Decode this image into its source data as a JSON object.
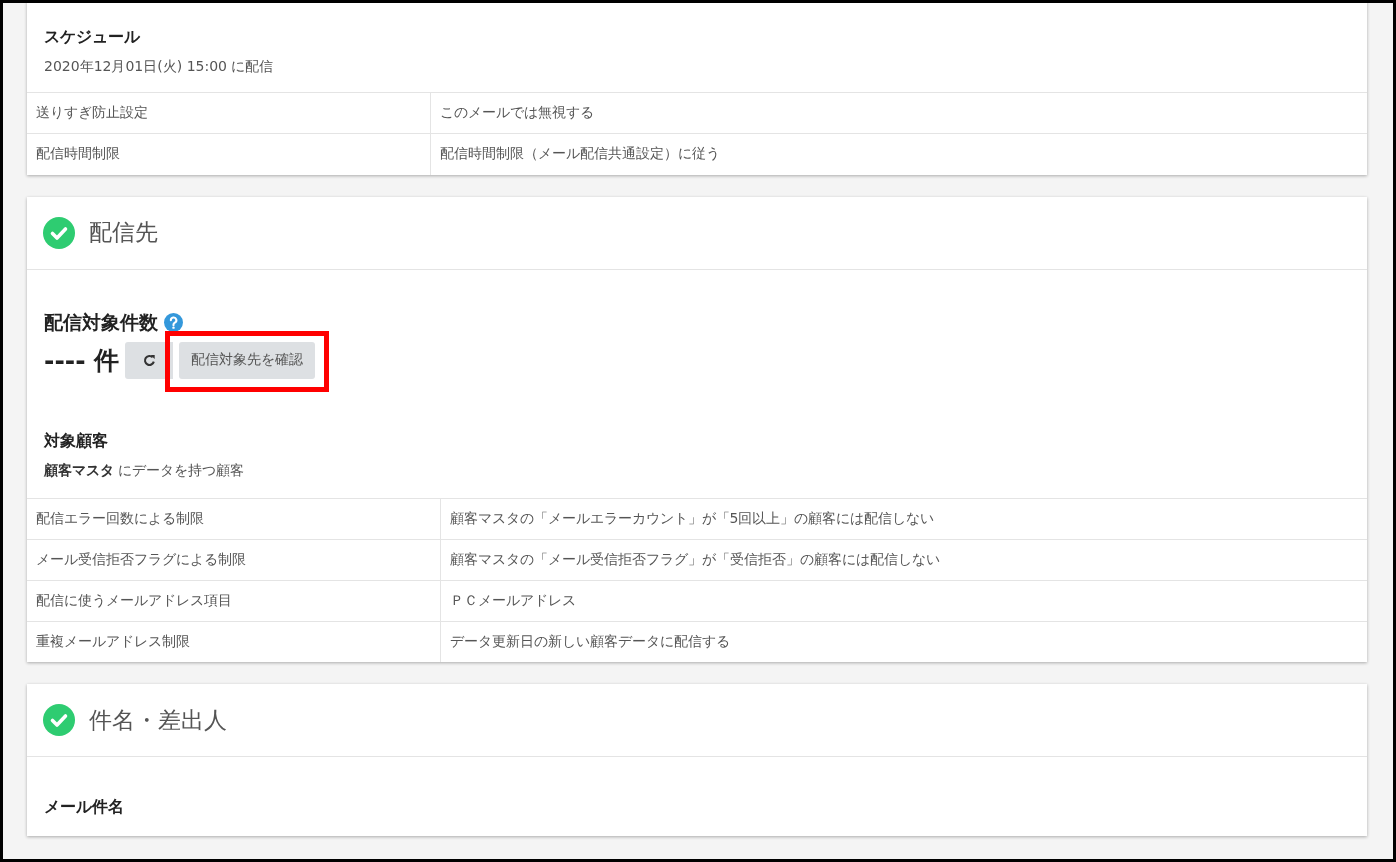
{
  "sections": [
    {
      "kind": "plain",
      "title": "スケジュール",
      "text": "2020年12月01日(火) 15:00 に配信",
      "table": [
        {
          "label": "送りすぎ防止設定",
          "value": "このメールでは無視する"
        },
        {
          "label": "配信時間制限",
          "value": "配信時間制限（メール配信共通設定）に従う"
        }
      ]
    },
    {
      "kind": "checked",
      "title": "配信先",
      "complete": true,
      "count_label": "配信対象件数",
      "count": "---- 件",
      "confirm_button": {
        "label": "配信対象先を確認",
        "highlighted": true
      },
      "subtitle": "対象顧客",
      "text": "**顧客マスタ** にデータを持つ顧客",
      "table": [
        {
          "label": "配信エラー回数による制限",
          "value": "顧客マスタの「メールエラーカウント」が「5回以上」の顧客には配信しない"
        },
        {
          "label": "メール受信拒否フラグによる制限",
          "value": "顧客マスタの「メール受信拒否フラグ」が「受信拒否」の顧客には配信しない"
        },
        {
          "label": "配信に使うメールアドレス項目",
          "value": "ＰＣメールアドレス"
        },
        {
          "label": "重複メールアドレス制限",
          "value": "データ更新日の新しい顧客データに配信する"
        }
      ]
    },
    {
      "kind": "checked",
      "title": "件名・差出人",
      "complete": true,
      "subtitle": "メール件名"
    }
  ]
}
